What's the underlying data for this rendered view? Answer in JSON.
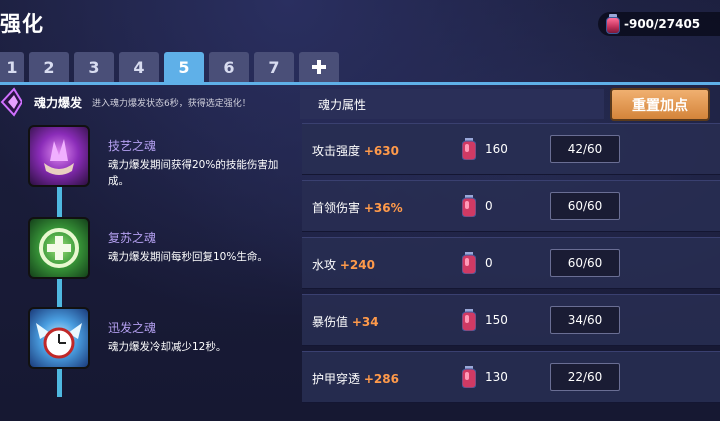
{
  "header": {
    "title": "强化",
    "currency_value": "-900/27405"
  },
  "tabs": [
    "1",
    "2",
    "3",
    "4",
    "5",
    "6",
    "7"
  ],
  "active_tab": "5",
  "burst": {
    "name": "魂力爆发",
    "description": "进入魂力爆发状态6秒，获得选定强化！"
  },
  "souls": [
    {
      "name": "技艺之魂",
      "description": "魂力爆发期间获得20%的技能伤害加成。",
      "icon": "purple-crystal-icon"
    },
    {
      "name": "复苏之魂",
      "description": "魂力爆发期间每秒回复10%生命。",
      "icon": "green-heal-icon"
    },
    {
      "name": "迅发之魂",
      "description": "魂力爆发冷却减少12秒。",
      "icon": "blue-clock-icon"
    }
  ],
  "attributes": {
    "header_label": "魂力属性",
    "reset_label": "重置加点",
    "rows": [
      {
        "name": "攻击强度",
        "bonus": "+630",
        "cost": "160",
        "level": "42/60"
      },
      {
        "name": "首领伤害",
        "bonus": "+36%",
        "cost": "0",
        "level": "60/60"
      },
      {
        "name": "水攻",
        "bonus": "+240",
        "cost": "0",
        "level": "60/60"
      },
      {
        "name": "暴伤值",
        "bonus": "+34",
        "cost": "150",
        "level": "34/60"
      },
      {
        "name": "护甲穿透",
        "bonus": "+286",
        "cost": "130",
        "level": "22/60"
      }
    ]
  },
  "colors": {
    "accent": "#5fb0e8",
    "bonus": "#ff9a4a",
    "reset_button": "#e09a56",
    "soul_name": "#b4a0f0"
  }
}
